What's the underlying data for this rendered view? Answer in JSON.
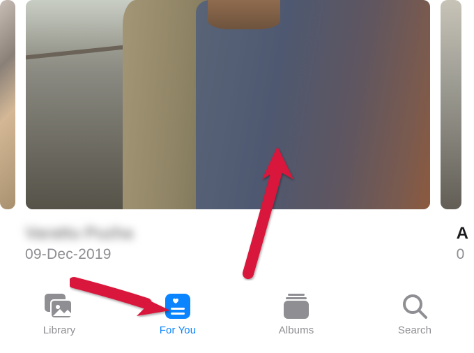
{
  "photos": {
    "main_card": {
      "title": "Varattu Puzha",
      "date": "09-Dec-2019"
    },
    "right_card": {
      "title_fragment": "A",
      "date_fragment": "0"
    }
  },
  "tabbar": {
    "tabs": [
      {
        "id": "library",
        "label": "Library",
        "active": false
      },
      {
        "id": "for-you",
        "label": "For You",
        "active": true
      },
      {
        "id": "albums",
        "label": "Albums",
        "active": false
      },
      {
        "id": "search",
        "label": "Search",
        "active": false
      }
    ]
  },
  "colors": {
    "accent": "#0a84ff",
    "inactive": "#8e8e93",
    "arrow": "#d9143a"
  }
}
